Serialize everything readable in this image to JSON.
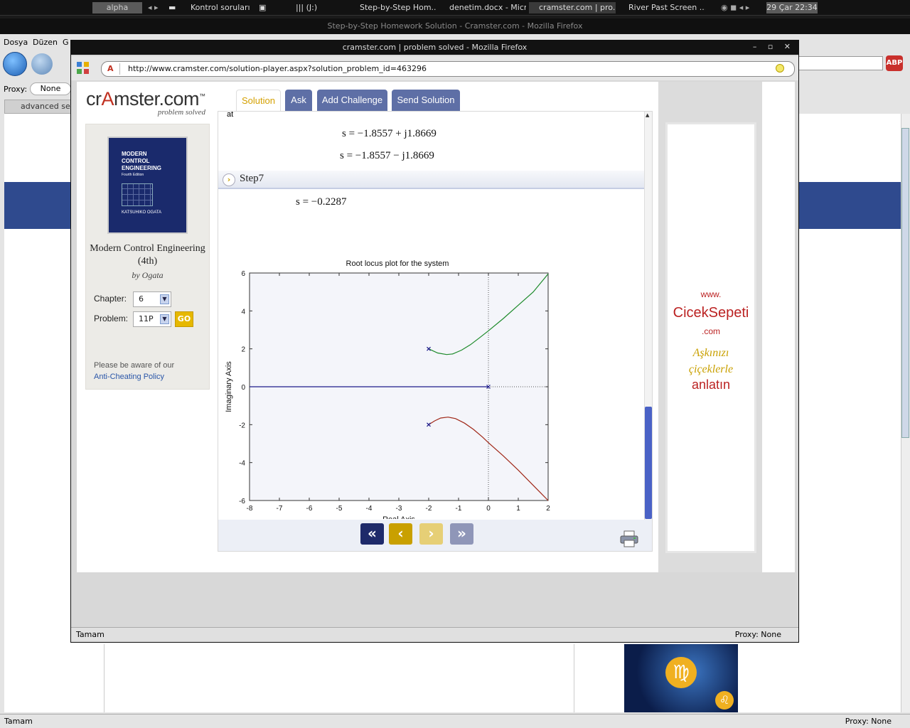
{
  "taskbar": {
    "workspace": "alpha",
    "items": [
      "Kontrol soruları",
      "||| (J:)",
      "Step-by-Step Hom...",
      "denetim.docx - Micr...",
      "cramster.com | pro...",
      "River Past Screen ..."
    ],
    "clock": "29 Çar 22:34"
  },
  "bg_window": {
    "title": "Step-by-Step Homework Solution - Cramster.com - Mozilla Firefox",
    "menu": [
      "Dosya",
      "Düzen",
      "G"
    ],
    "proxy_label": "Proxy:",
    "proxy_value": "None",
    "tab_label": "advanced sear",
    "status_left": "Tamam",
    "status_right": "Proxy: None"
  },
  "popup": {
    "title": "cramster.com | problem solved - Mozilla Firefox",
    "url": "http://www.cramster.com/solution-player.aspx?solution_problem_id=463296",
    "status_left": "Tamam",
    "status_right": "Proxy: None"
  },
  "site": {
    "logo": "crAmster.com",
    "logo_tm": "™",
    "tagline": "problem solved",
    "book_cover_title": [
      "MODERN",
      "CONTROL",
      "ENGINEERING"
    ],
    "book_cover_edition": "Fourth Edition",
    "book_cover_author": "KATSUHIKO OGATA",
    "book_title": "Modern Control Engineering (4th)",
    "book_author": "by Ogata",
    "chapter_label": "Chapter:",
    "chapter_value": "6",
    "problem_label": "Problem:",
    "problem_value": "11P",
    "go": "GO",
    "notice": "Please be aware of our",
    "notice_link": "Anti-Cheating Policy"
  },
  "tabs": [
    "Solution",
    "Ask",
    "Add Challenge",
    "Send Solution"
  ],
  "solution": {
    "cut_text": "at",
    "eq1": "s = −1.8557 + j1.8669",
    "eq2": "s = −1.8557 − j1.8669",
    "step_label": "Step7",
    "eq3": "s = −0.2287"
  },
  "nav": {
    "first": "«",
    "prev": "‹",
    "next": "›",
    "last": "»"
  },
  "ad": {
    "www": "www.",
    "brand": "CicekSepeti",
    "com": ".com",
    "slogan": [
      "Aşkınızı",
      "çiçeklerle"
    ],
    "slogan_end": "anlatın"
  },
  "chart_data": {
    "type": "line",
    "title": "Root locus plot for the system",
    "ylabel": "Imaginary Axis",
    "xlabel": "Real Axis",
    "xlim": [
      -8,
      2
    ],
    "ylim": [
      -6,
      6
    ],
    "xticks": [
      -8,
      -7,
      -6,
      -5,
      -4,
      -3,
      -2,
      -1,
      0,
      1,
      2
    ],
    "yticks": [
      6,
      4,
      2,
      0,
      -2,
      -4,
      -6
    ],
    "poles": [
      [
        -2,
        2
      ],
      [
        -2,
        -2
      ],
      [
        0,
        0
      ]
    ],
    "series": [
      {
        "color": "#1d8a2a",
        "x": [
          -2,
          -1.7,
          -1.4,
          -1.2,
          -0.9,
          -0.6,
          -0.3,
          0,
          0.5,
          1,
          1.5,
          2
        ],
        "y": [
          2,
          1.78,
          1.7,
          1.73,
          1.93,
          2.22,
          2.58,
          2.95,
          3.6,
          4.3,
          5.0,
          5.95
        ]
      },
      {
        "color": "#a02818",
        "x": [
          -2,
          -1.8,
          -1.6,
          -1.35,
          -1.1,
          -0.8,
          -0.5,
          -0.2,
          0,
          0.5,
          1,
          1.5,
          2
        ],
        "y": [
          -2,
          -1.8,
          -1.65,
          -1.6,
          -1.68,
          -1.92,
          -2.25,
          -2.65,
          -2.95,
          -3.65,
          -4.4,
          -5.2,
          -6
        ]
      },
      {
        "color": "#1c1a8a",
        "x": [
          -8,
          0
        ],
        "y": [
          0,
          0
        ]
      }
    ]
  }
}
